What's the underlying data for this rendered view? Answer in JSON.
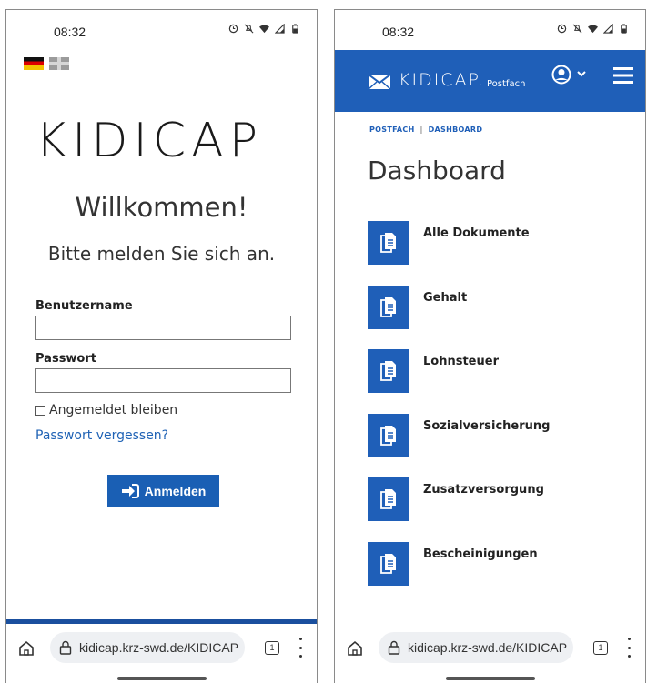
{
  "status_bar": {
    "time": "08:32"
  },
  "login_screen": {
    "brand_logo_text": "KIDICAP",
    "welcome": "Willkommen!",
    "subtitle": "Bitte melden Sie sich an.",
    "username_label": "Benutzername",
    "username_value": "",
    "password_label": "Passwort",
    "password_value": "",
    "remember_label": "Angemeldet bleiben",
    "forgot_link": "Passwort vergessen?",
    "login_button": "Anmelden",
    "languages": [
      "de",
      "en"
    ]
  },
  "dashboard_screen": {
    "app_brand": "KIDICAP.",
    "app_brand_sub": "Postfach",
    "breadcrumb": [
      "POSTFACH",
      "DASHBOARD"
    ],
    "breadcrumb_sep": "|",
    "title": "Dashboard",
    "items": [
      {
        "label": "Alle Dokumente"
      },
      {
        "label": "Gehalt"
      },
      {
        "label": "Lohnsteuer"
      },
      {
        "label": "Sozialversicherung"
      },
      {
        "label": "Zusatzversorgung"
      },
      {
        "label": "Bescheinigungen"
      }
    ]
  },
  "browser": {
    "url": "kidicap.krz-swd.de/KIDICAP",
    "tab_count": "1"
  },
  "colors": {
    "primary": "#1f5fb8",
    "link": "#1f62b5",
    "text": "#222222"
  }
}
